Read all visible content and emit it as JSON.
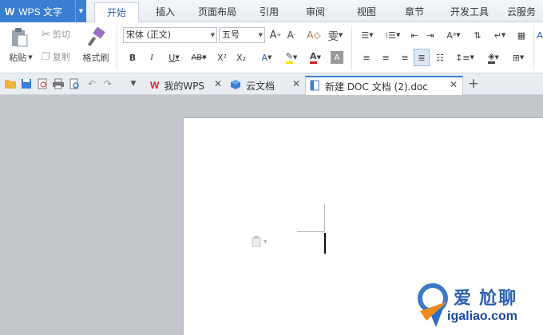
{
  "app": {
    "logo": "W",
    "name": "WPS 文字",
    "accent": "#3b7fd3"
  },
  "menu": {
    "tabs": [
      "开始",
      "插入",
      "页面布局",
      "引用",
      "审阅",
      "视图",
      "章节",
      "开发工具",
      "云服务"
    ],
    "active_tab": "开始"
  },
  "ribbon": {
    "paste_label": "粘贴",
    "cut_label": "剪切",
    "copy_label": "复制",
    "format_painter_label": "格式刷",
    "font_name": "宋体 (正文)",
    "font_size": "五号",
    "bold": "B",
    "italic": "I",
    "underline": "U",
    "strikethrough": "AB",
    "superscript": "X²",
    "subscript": "X₂",
    "font_color_letter": "A"
  },
  "tabbar": {
    "tabs": [
      {
        "label": "我的WPS",
        "icon": "wps-logo-icon"
      },
      {
        "label": "云文档",
        "icon": "cloud-doc-icon"
      },
      {
        "label": "新建 DOC 文档 (2).doc",
        "icon": "doc-icon"
      }
    ],
    "active_tab": "新建 DOC 文档 (2).doc",
    "new_tab_symbol": "+"
  },
  "watermark": {
    "text": "爱 尬聊",
    "url": "igaliao.com"
  },
  "colors": {
    "workspace_bg": "#c4c7cc",
    "page_bg": "#ffffff",
    "tab_accent": "#3b7fd3"
  }
}
